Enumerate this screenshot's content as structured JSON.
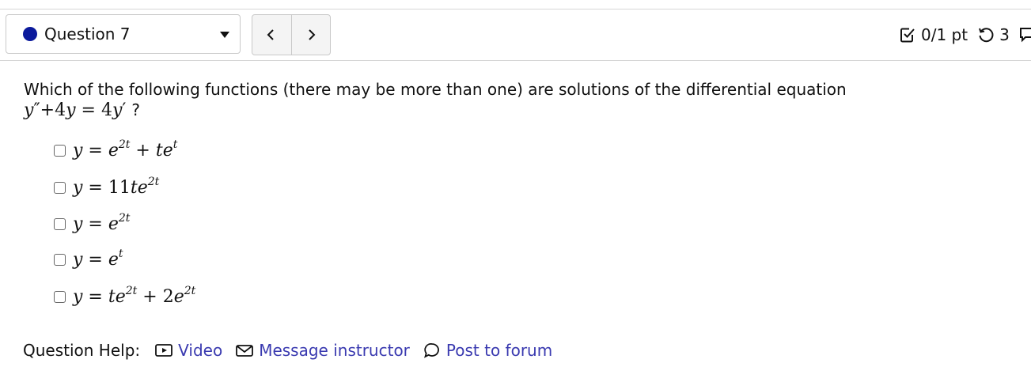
{
  "header": {
    "question_selector": {
      "label": "Question 7",
      "status_color": "#0b1a9c"
    },
    "nav": {
      "prev_icon": "chevron-left-icon",
      "next_icon": "chevron-right-icon"
    },
    "score": "0/1 pt",
    "retries": "3"
  },
  "question": {
    "prompt": "Which of the following functions (there may be more than one) are solutions of the differential equation",
    "equation": "y″+4y = 4y′ ?",
    "choices": [
      "y = e^2t + te^t",
      "y = 11te^2t",
      "y = e^2t",
      "y = e^t",
      "y = te^2t + 2e^2t"
    ]
  },
  "help": {
    "label": "Question Help:",
    "video": "Video",
    "message": "Message instructor",
    "forum": "Post to forum"
  },
  "colors": {
    "link": "#3a3ab0",
    "rule": "#d6d6d6"
  }
}
